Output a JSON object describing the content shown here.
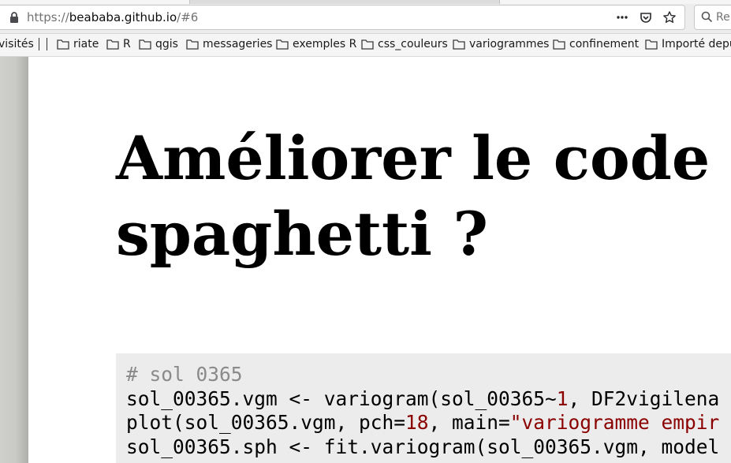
{
  "browser": {
    "url_prefix": "https://",
    "url_domain": "beababa.github.io",
    "url_suffix": "/#6",
    "search_placeholder": "Re"
  },
  "bookmarks": {
    "partial_first": "visités",
    "items": [
      "riate",
      "R",
      "qgis",
      "messageries",
      "exemples R",
      "css_couleurs",
      "variogrammes",
      "confinement",
      "Importé depuis"
    ]
  },
  "slide": {
    "title_line1": "Améliorer le code",
    "title_line2": "spaghetti ?",
    "code": {
      "line1_comment": "# sol 0365",
      "line2_a": "sol_00365.vgm <- variogram(sol_00365~",
      "line2_num": "1",
      "line2_b": ", DF2vigilena",
      "line3_a": "plot(sol_00365.vgm, pch=",
      "line3_num": "18",
      "line3_b": ", main=",
      "line3_str": "\"variogramme empir",
      "line4": "sol_00365.sph <- fit.variogram(sol_00365.vgm, model"
    }
  },
  "colors": {
    "code_background": "#ececec",
    "code_literal": "#8b0000",
    "code_comment": "#8a8a8a"
  }
}
